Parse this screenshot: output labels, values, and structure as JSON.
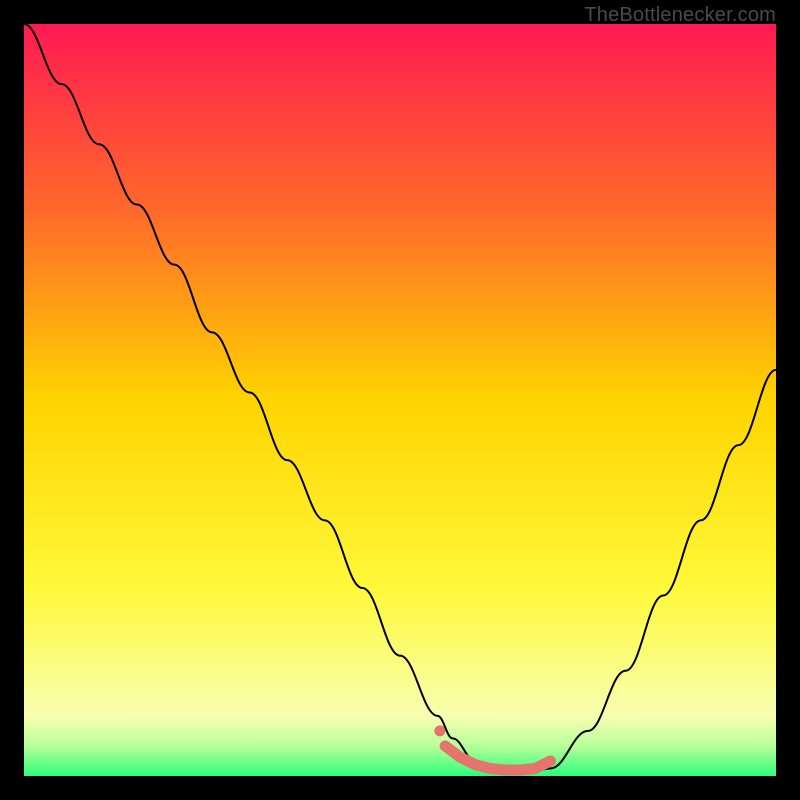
{
  "watermark": "TheBottlenecker.com",
  "chart_data": {
    "type": "line",
    "title": "",
    "xlabel": "",
    "ylabel": "",
    "xlim": [
      0,
      100
    ],
    "ylim": [
      0,
      100
    ],
    "series": [
      {
        "name": "bottleneck-curve",
        "x": [
          0,
          5,
          10,
          15,
          20,
          25,
          30,
          35,
          40,
          45,
          50,
          55,
          57,
          60,
          63,
          65,
          67,
          70,
          75,
          80,
          85,
          90,
          95,
          100
        ],
        "values": [
          100,
          92,
          84,
          76,
          68,
          59,
          51,
          42,
          34,
          25,
          16,
          8,
          5,
          2,
          1,
          0.5,
          0.5,
          1,
          6,
          14,
          24,
          34,
          44,
          54
        ]
      },
      {
        "name": "optimal-zone-markers",
        "x": [
          56,
          58,
          60,
          62,
          64,
          66,
          68,
          70
        ],
        "values": [
          4,
          2.5,
          1.5,
          1,
          0.8,
          0.8,
          1,
          2
        ]
      }
    ],
    "gradient_stops": [
      {
        "offset": 0,
        "color": "#ff1a52"
      },
      {
        "offset": 25,
        "color": "#ff6a2a"
      },
      {
        "offset": 50,
        "color": "#ffd400"
      },
      {
        "offset": 75,
        "color": "#fff93a"
      },
      {
        "offset": 92,
        "color": "#f8ffb0"
      },
      {
        "offset": 96,
        "color": "#b8ff9a"
      },
      {
        "offset": 100,
        "color": "#2dff7a"
      }
    ],
    "marker_color": "#e4746d",
    "curve_color": "#000000"
  }
}
